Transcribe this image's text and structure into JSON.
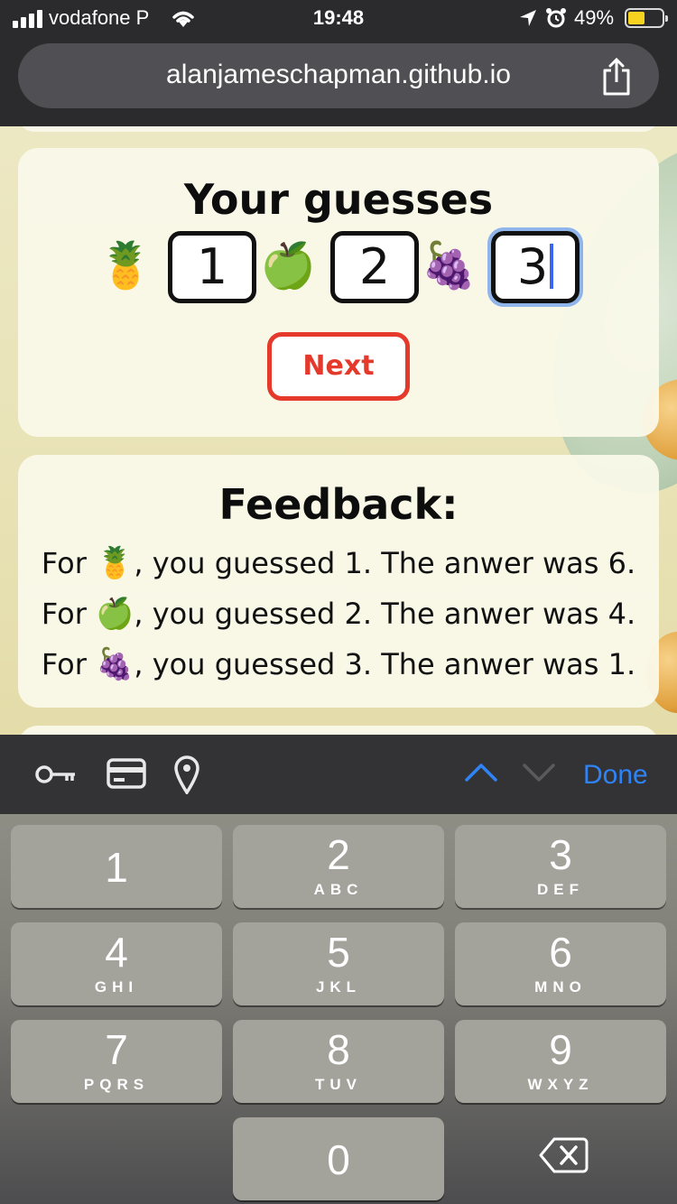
{
  "status_bar": {
    "carrier": "vodafone P",
    "time": "19:48",
    "battery_percent": "49%",
    "battery_level": 0.49,
    "signal_bars": 4,
    "icons": [
      "signal-icon",
      "wifi-icon",
      "location-arrow-icon",
      "alarm-icon",
      "battery-icon"
    ]
  },
  "browser": {
    "url": "alanjameschapman.github.io",
    "share_icon": "share-icon"
  },
  "guesses_card": {
    "heading": "Your guesses",
    "items": [
      {
        "fruit": "🍍",
        "fruit_name": "pineapple",
        "value": "1"
      },
      {
        "fruit": "🍏",
        "fruit_name": "green-apple",
        "value": "2"
      },
      {
        "fruit": "🍇",
        "fruit_name": "grapes",
        "value": "3"
      }
    ],
    "next_label": "Next"
  },
  "feedback_card": {
    "heading": "Feedback:",
    "lines": [
      {
        "prefix": "For",
        "fruit": "🍍",
        "text": ", you guessed 1. The anwer was 6."
      },
      {
        "prefix": "For",
        "fruit": "🍏",
        "text": ", you guessed 2. The anwer was 4."
      },
      {
        "prefix": "For",
        "fruit": "🍇",
        "text": ", you guessed 3. The anwer was 1."
      }
    ]
  },
  "accessory_bar": {
    "icons": [
      "key-icon",
      "credit-card-icon",
      "location-pin-icon"
    ],
    "prev_icon": "chevron-up-icon",
    "next_icon": "chevron-down-icon",
    "done_label": "Done"
  },
  "keypad": {
    "keys": [
      {
        "num": "1",
        "letters": ""
      },
      {
        "num": "2",
        "letters": "ABC"
      },
      {
        "num": "3",
        "letters": "DEF"
      },
      {
        "num": "4",
        "letters": "GHI"
      },
      {
        "num": "5",
        "letters": "JKL"
      },
      {
        "num": "6",
        "letters": "MNO"
      },
      {
        "num": "7",
        "letters": "PQRS"
      },
      {
        "num": "8",
        "letters": "TUV"
      },
      {
        "num": "9",
        "letters": "WXYZ"
      },
      {
        "num": "0",
        "letters": ""
      }
    ],
    "delete_icon": "backspace-icon"
  },
  "colors": {
    "accent_red": "#e53a2b",
    "link_blue": "#2f84f5",
    "focus_ring": "#8fb5ea"
  }
}
